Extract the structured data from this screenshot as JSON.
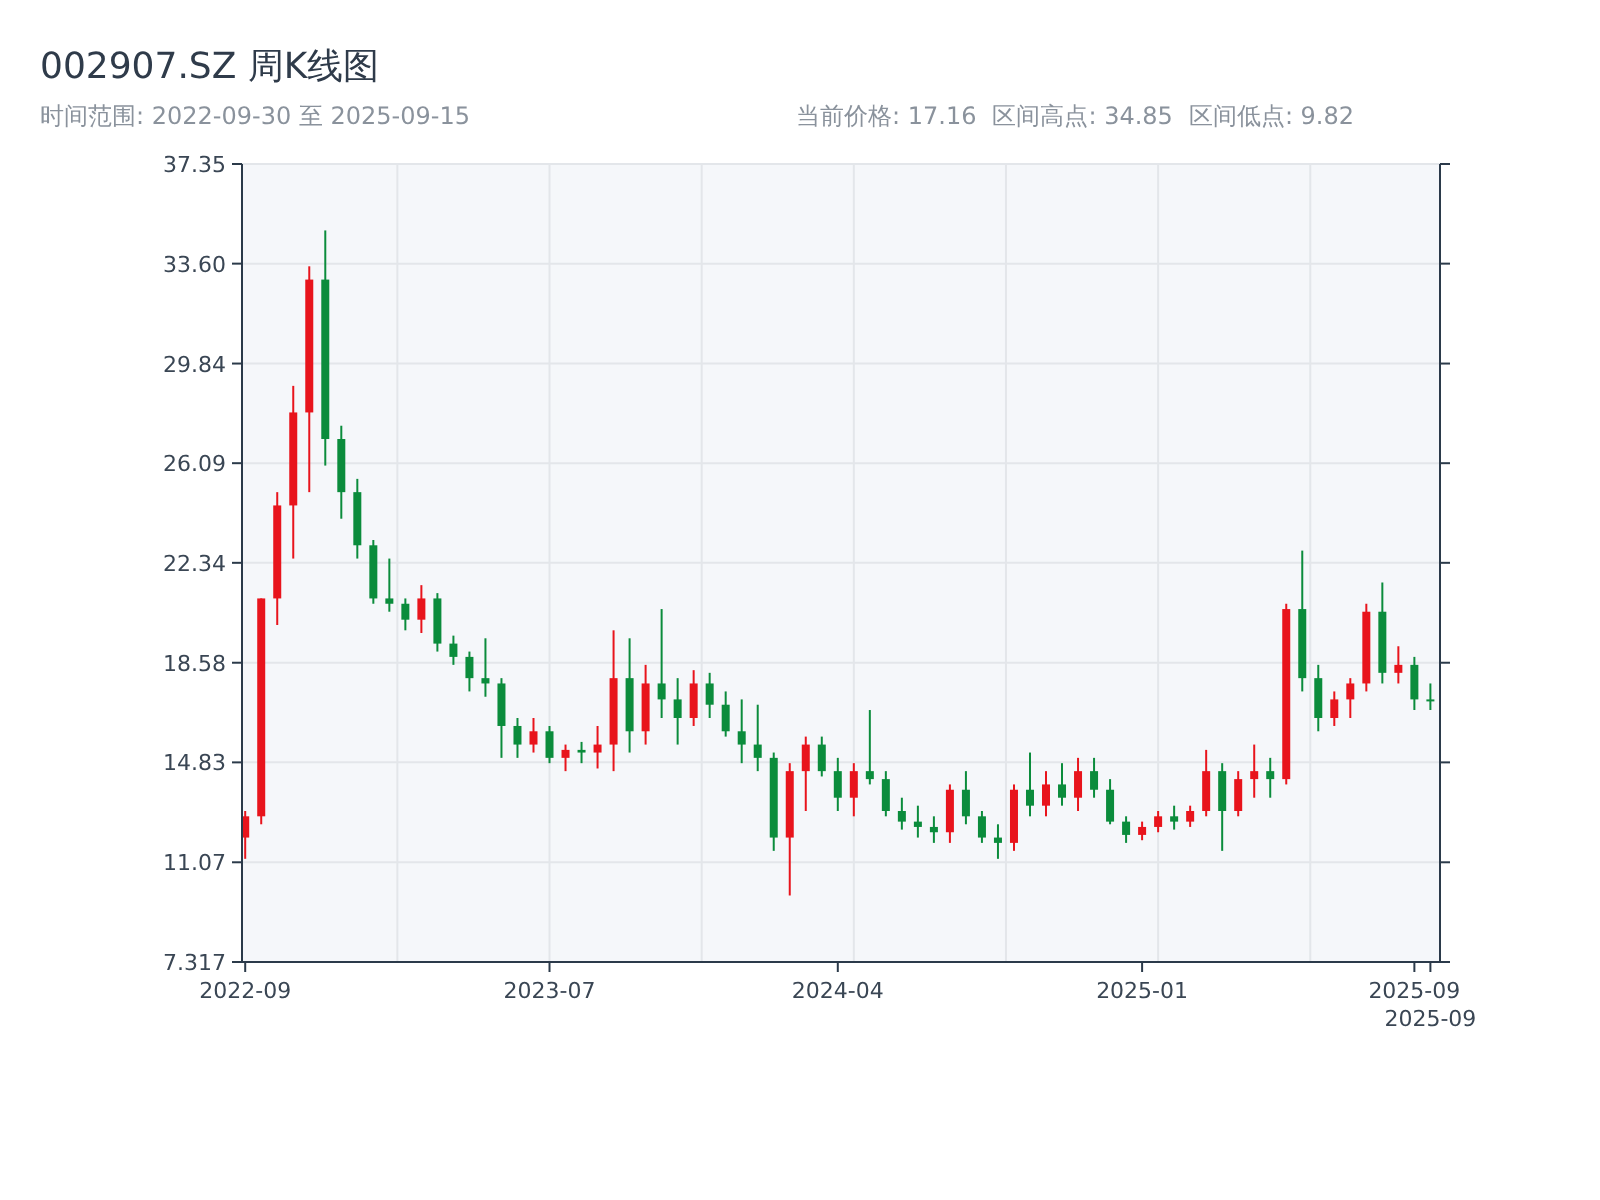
{
  "title": "002907.SZ 周K线图",
  "range_label": "时间范围: 2022-09-30 至 2025-09-15",
  "stats": [
    "当前价格: 17.16",
    "区间高点: 34.85",
    "区间低点: 9.82"
  ],
  "candle_styles": [
    {
      "kind": "up",
      "color": "#e8141c"
    },
    {
      "kind": "down",
      "color": "#0b8c3c"
    }
  ],
  "chart_data": {
    "type": "candlestick",
    "grid": true,
    "ylim": [
      7.317,
      37.35
    ],
    "categories": [
      "2022-09",
      null,
      null,
      null,
      null,
      null,
      null,
      null,
      null,
      null,
      null,
      null,
      null,
      null,
      null,
      null,
      null,
      null,
      null,
      "2023-07",
      null,
      null,
      null,
      null,
      null,
      null,
      null,
      null,
      null,
      null,
      null,
      null,
      null,
      null,
      null,
      null,
      null,
      "2024-04",
      null,
      null,
      null,
      null,
      null,
      null,
      null,
      null,
      null,
      null,
      null,
      null,
      null,
      null,
      null,
      null,
      null,
      null,
      "2025-01",
      null,
      null,
      null,
      null,
      null,
      null,
      null,
      null,
      null,
      null,
      null,
      null,
      null,
      null,
      null,
      null,
      "2025-09",
      "2025-09"
    ],
    "yticks": [
      {
        "value": 7.317,
        "label": "7.317"
      },
      {
        "value": 11.07,
        "label": "11.07"
      },
      {
        "value": 14.83,
        "label": "14.83"
      },
      {
        "value": 18.58,
        "label": "18.58"
      },
      {
        "value": 22.34,
        "label": "22.34"
      },
      {
        "value": 26.09,
        "label": "26.09"
      },
      {
        "value": 29.84,
        "label": "29.84"
      },
      {
        "value": 33.6,
        "label": "33.60"
      },
      {
        "value": 37.35,
        "label": "37.35"
      }
    ],
    "ohlc": [
      [
        12.0,
        13.0,
        11.2,
        12.8
      ],
      [
        12.8,
        21.0,
        12.5,
        21.0
      ],
      [
        21.0,
        25.0,
        20.0,
        24.5
      ],
      [
        24.5,
        29.0,
        22.5,
        28.0
      ],
      [
        28.0,
        33.5,
        25.0,
        33.0
      ],
      [
        33.0,
        34.85,
        26.0,
        27.0
      ],
      [
        27.0,
        27.5,
        24.0,
        25.0
      ],
      [
        25.0,
        25.5,
        22.5,
        23.0
      ],
      [
        23.0,
        23.2,
        20.8,
        21.0
      ],
      [
        21.0,
        22.5,
        20.5,
        20.8
      ],
      [
        20.8,
        21.0,
        19.8,
        20.2
      ],
      [
        20.2,
        21.5,
        19.7,
        21.0
      ],
      [
        21.0,
        21.2,
        19.0,
        19.3
      ],
      [
        19.3,
        19.6,
        18.5,
        18.8
      ],
      [
        18.8,
        19.0,
        17.5,
        18.0
      ],
      [
        18.0,
        19.5,
        17.3,
        17.8
      ],
      [
        17.8,
        18.0,
        15.0,
        16.2
      ],
      [
        16.2,
        16.5,
        15.0,
        15.5
      ],
      [
        15.5,
        16.5,
        15.2,
        16.0
      ],
      [
        16.0,
        16.2,
        14.8,
        15.0
      ],
      [
        15.0,
        15.5,
        14.5,
        15.3
      ],
      [
        15.3,
        15.6,
        14.8,
        15.2
      ],
      [
        15.2,
        16.2,
        14.6,
        15.5
      ],
      [
        15.5,
        19.8,
        14.5,
        18.0
      ],
      [
        18.0,
        19.5,
        15.2,
        16.0
      ],
      [
        16.0,
        18.5,
        15.5,
        17.8
      ],
      [
        17.8,
        20.6,
        16.5,
        17.2
      ],
      [
        17.2,
        18.0,
        15.5,
        16.5
      ],
      [
        16.5,
        18.3,
        16.2,
        17.8
      ],
      [
        17.8,
        18.2,
        16.5,
        17.0
      ],
      [
        17.0,
        17.5,
        15.8,
        16.0
      ],
      [
        16.0,
        17.2,
        14.8,
        15.5
      ],
      [
        15.5,
        17.0,
        14.5,
        15.0
      ],
      [
        15.0,
        15.2,
        11.5,
        12.0
      ],
      [
        12.0,
        14.8,
        9.82,
        14.5
      ],
      [
        14.5,
        15.8,
        13.0,
        15.5
      ],
      [
        15.5,
        15.8,
        14.3,
        14.5
      ],
      [
        14.5,
        15.0,
        13.0,
        13.5
      ],
      [
        13.5,
        14.8,
        12.8,
        14.5
      ],
      [
        14.5,
        16.8,
        14.0,
        14.2
      ],
      [
        14.2,
        14.5,
        12.8,
        13.0
      ],
      [
        13.0,
        13.5,
        12.3,
        12.6
      ],
      [
        12.6,
        13.2,
        12.0,
        12.4
      ],
      [
        12.4,
        12.8,
        11.8,
        12.2
      ],
      [
        12.2,
        14.0,
        11.8,
        13.8
      ],
      [
        13.8,
        14.5,
        12.5,
        12.8
      ],
      [
        12.8,
        13.0,
        11.8,
        12.0
      ],
      [
        12.0,
        12.5,
        11.2,
        11.8
      ],
      [
        11.8,
        14.0,
        11.5,
        13.8
      ],
      [
        13.8,
        15.2,
        12.8,
        13.2
      ],
      [
        13.2,
        14.5,
        12.8,
        14.0
      ],
      [
        14.0,
        14.8,
        13.2,
        13.5
      ],
      [
        13.5,
        15.0,
        13.0,
        14.5
      ],
      [
        14.5,
        15.0,
        13.5,
        13.8
      ],
      [
        13.8,
        14.2,
        12.5,
        12.6
      ],
      [
        12.6,
        12.8,
        11.8,
        12.1
      ],
      [
        12.1,
        12.6,
        11.9,
        12.4
      ],
      [
        12.4,
        13.0,
        12.2,
        12.8
      ],
      [
        12.8,
        13.2,
        12.3,
        12.6
      ],
      [
        12.6,
        13.2,
        12.4,
        13.0
      ],
      [
        13.0,
        15.3,
        12.8,
        14.5
      ],
      [
        14.5,
        14.8,
        11.5,
        13.0
      ],
      [
        13.0,
        14.5,
        12.8,
        14.2
      ],
      [
        14.2,
        15.5,
        13.5,
        14.5
      ],
      [
        14.5,
        15.0,
        13.5,
        14.2
      ],
      [
        14.2,
        20.8,
        14.0,
        20.6
      ],
      [
        20.6,
        22.8,
        17.5,
        18.0
      ],
      [
        18.0,
        18.5,
        16.0,
        16.5
      ],
      [
        16.5,
        17.5,
        16.2,
        17.2
      ],
      [
        17.2,
        18.0,
        16.5,
        17.8
      ],
      [
        17.8,
        20.8,
        17.5,
        20.5
      ],
      [
        20.5,
        21.6,
        17.8,
        18.2
      ],
      [
        18.2,
        19.2,
        17.8,
        18.5
      ],
      [
        18.5,
        18.8,
        16.8,
        17.2
      ],
      [
        17.2,
        17.8,
        16.8,
        17.16
      ]
    ]
  }
}
